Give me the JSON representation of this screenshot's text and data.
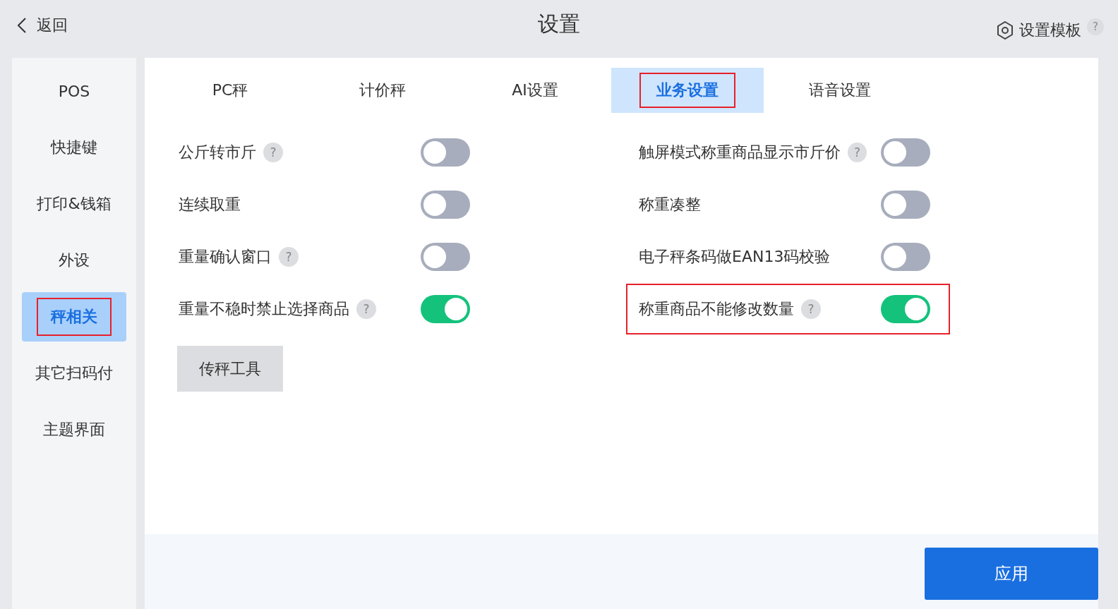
{
  "header": {
    "back_label": "返回",
    "title": "设置",
    "template_label": "设置模板",
    "template_help": "?"
  },
  "sidebar": {
    "items": [
      {
        "label": "POS",
        "selected": false,
        "annotated": false
      },
      {
        "label": "快捷键",
        "selected": false,
        "annotated": false
      },
      {
        "label": "打印&钱箱",
        "selected": false,
        "annotated": false
      },
      {
        "label": "外设",
        "selected": false,
        "annotated": false
      },
      {
        "label": "秤相关",
        "selected": true,
        "annotated": true
      },
      {
        "label": "其它扫码付",
        "selected": false,
        "annotated": false
      },
      {
        "label": "主题界面",
        "selected": false,
        "annotated": false
      }
    ]
  },
  "tabs": [
    {
      "label": "PC秤",
      "selected": false,
      "annotated": false
    },
    {
      "label": "计价秤",
      "selected": false,
      "annotated": false
    },
    {
      "label": "AI设置",
      "selected": false,
      "annotated": false
    },
    {
      "label": "业务设置",
      "selected": true,
      "annotated": true
    },
    {
      "label": "语音设置",
      "selected": false,
      "annotated": false
    }
  ],
  "settings": {
    "columns": [
      [
        {
          "label": "公斤转市斤",
          "help": "?",
          "on": false,
          "annotated": false
        },
        {
          "label": "连续取重",
          "on": false,
          "annotated": false
        },
        {
          "label": "重量确认窗口",
          "help": "?",
          "on": false,
          "annotated": false
        },
        {
          "label": "重量不稳时禁止选择商品",
          "help": "?",
          "on": true,
          "annotated": false
        }
      ],
      [
        {
          "label": "触屏模式称重商品显示市斤价",
          "help": "?",
          "on": false,
          "annotated": false
        },
        {
          "label": "称重凑整",
          "on": false,
          "annotated": false
        },
        {
          "label": "电子秤条码做EAN13码校验",
          "on": false,
          "annotated": false
        },
        {
          "label": "称重商品不能修改数量",
          "help": "?",
          "on": true,
          "annotated": true
        }
      ]
    ]
  },
  "tool_button": "传秤工具",
  "apply_button": "应用"
}
